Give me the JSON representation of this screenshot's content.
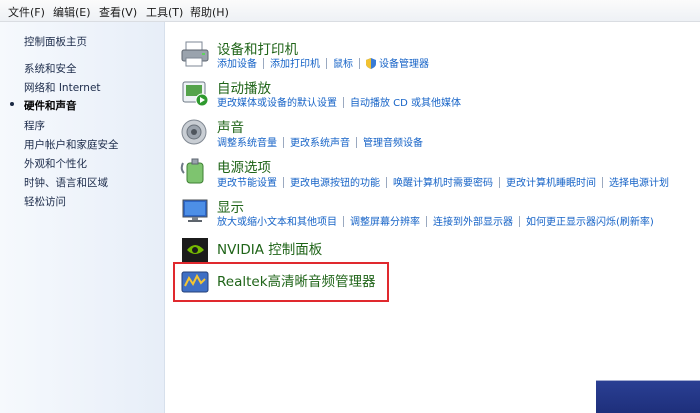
{
  "menubar": {
    "items": [
      "文件(F)",
      "编辑(E)",
      "查看(V)",
      "工具(T)",
      "帮助(H)"
    ]
  },
  "sidebar": {
    "items": [
      {
        "label": "控制面板主页",
        "current": false
      },
      {
        "label": "系统和安全",
        "current": false
      },
      {
        "label": "网络和 Internet",
        "current": false
      },
      {
        "label": "硬件和声音",
        "current": true
      },
      {
        "label": "程序",
        "current": false
      },
      {
        "label": "用户帐户和家庭安全",
        "current": false
      },
      {
        "label": "外观和个性化",
        "current": false
      },
      {
        "label": "时钟、语言和区域",
        "current": false
      },
      {
        "label": "轻松访问",
        "current": false
      }
    ]
  },
  "categories": [
    {
      "icon": "printer-icon",
      "title": "设备和打印机",
      "links": [
        "添加设备",
        "添加打印机",
        "鼠标",
        "设备管理器"
      ]
    },
    {
      "icon": "autoplay-icon",
      "title": "自动播放",
      "links": [
        "更改媒体或设备的默认设置",
        "自动播放 CD 或其他媒体"
      ]
    },
    {
      "icon": "speaker-icon",
      "title": "声音",
      "links": [
        "调整系统音量",
        "更改系统声音",
        "管理音频设备"
      ]
    },
    {
      "icon": "power-icon",
      "title": "电源选项",
      "links": [
        "更改节能设置",
        "更改电源按钮的功能",
        "唤醒计算机时需要密码",
        "更改计算机睡眠时间",
        "选择电源计划"
      ]
    },
    {
      "icon": "display-icon",
      "title": "显示",
      "links": [
        "放大或缩小文本和其他项目",
        "调整屏幕分辨率",
        "连接到外部显示器",
        "如何更正显示器闪烁(刷新率)"
      ]
    },
    {
      "icon": "nvidia-icon",
      "title": "NVIDIA 控制面板",
      "links": []
    },
    {
      "icon": "realtek-icon",
      "title": "Realtek高清晰音频管理器",
      "links": []
    }
  ],
  "colors": {
    "title_green": "#1f6418",
    "link_blue": "#1663c7",
    "highlight_red": "#e0292e"
  }
}
